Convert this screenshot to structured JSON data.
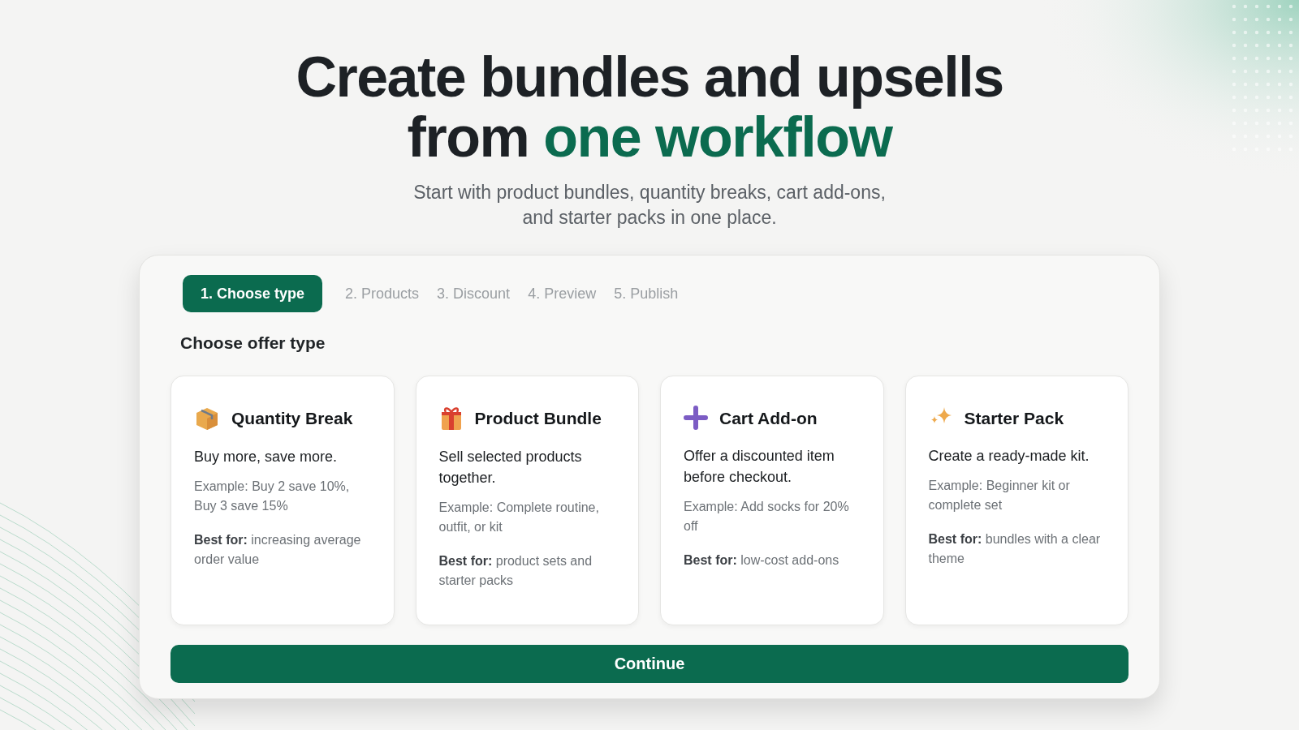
{
  "hero": {
    "title_line_1": "Create bundles and upsells",
    "title_line_2_lead": "from",
    "title_line_2_accent": "one workflow",
    "subtitle_line_1": "Start with product bundles, quantity breaks, cart add-ons,",
    "subtitle_line_2": "and starter packs in one place."
  },
  "steps": [
    {
      "label": "1. Choose type",
      "selected": true
    },
    {
      "label": "2. Products",
      "selected": false
    },
    {
      "label": "3. Discount",
      "selected": false
    },
    {
      "label": "4. Preview",
      "selected": false
    },
    {
      "label": "5. Publish",
      "selected": false
    }
  ],
  "section_title": "Choose offer type",
  "offer_types": [
    {
      "kind": "box",
      "title": "Quantity Break",
      "summary": "Buy more, save more.",
      "example": "Example: Buy 2 save 10%, Buy 3 save 15%",
      "best_for": "**Best for:** increasing average order value"
    },
    {
      "kind": "gift",
      "title": "Product Bundle",
      "summary": "Sell selected products together.",
      "example": "Example: Complete routine, outfit, or kit",
      "best_for": "**Best for:** product sets and starter packs"
    },
    {
      "kind": "plus",
      "title": "Cart Add-on",
      "summary": "Offer a discounted item before checkout.",
      "example": "Example: Add socks for 20% off",
      "best_for": "**Best for:** low-cost add-ons"
    },
    {
      "kind": "sparkle",
      "title": "Starter Pack",
      "summary": "Create a ready-made kit.",
      "example": "Example: Beginner kit or complete set",
      "best_for": "**Best for:** bundles with a clear theme"
    }
  ],
  "continue_button": "Continue"
}
